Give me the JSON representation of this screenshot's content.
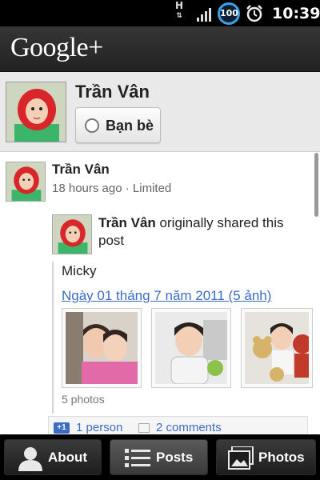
{
  "status_bar": {
    "network_type": "H",
    "battery_level": "100",
    "time": "10:39",
    "icons": [
      "signal-icon",
      "battery-icon",
      "alarm-icon"
    ]
  },
  "app_bar": {
    "title": "Google+"
  },
  "profile": {
    "name": "Trần Vân",
    "circle_button_label": "Bạn bè"
  },
  "post": {
    "author": "Trần Vân",
    "time": "18 hours ago",
    "separator": "·",
    "visibility": "Limited",
    "shared": {
      "author": "Trần Vân",
      "shared_text": "originally shared this post",
      "caption": "Micky",
      "album_link": "Ngày 01 tháng 7 năm 2011 (5 ảnh)",
      "photos_count": "5 photos"
    },
    "actions": {
      "plus_one_label": "+1",
      "plus_one_count": "1 person",
      "comments_count": "2 comments"
    }
  },
  "tabs": [
    {
      "label": "About",
      "icon": "person-icon"
    },
    {
      "label": "Posts",
      "icon": "list-icon",
      "active": true
    },
    {
      "label": "Photos",
      "icon": "photos-icon"
    }
  ],
  "colors": {
    "link": "#3b6cc4",
    "battery_ring": "#3aa0e8",
    "header_bg": "#e9e9e9"
  }
}
